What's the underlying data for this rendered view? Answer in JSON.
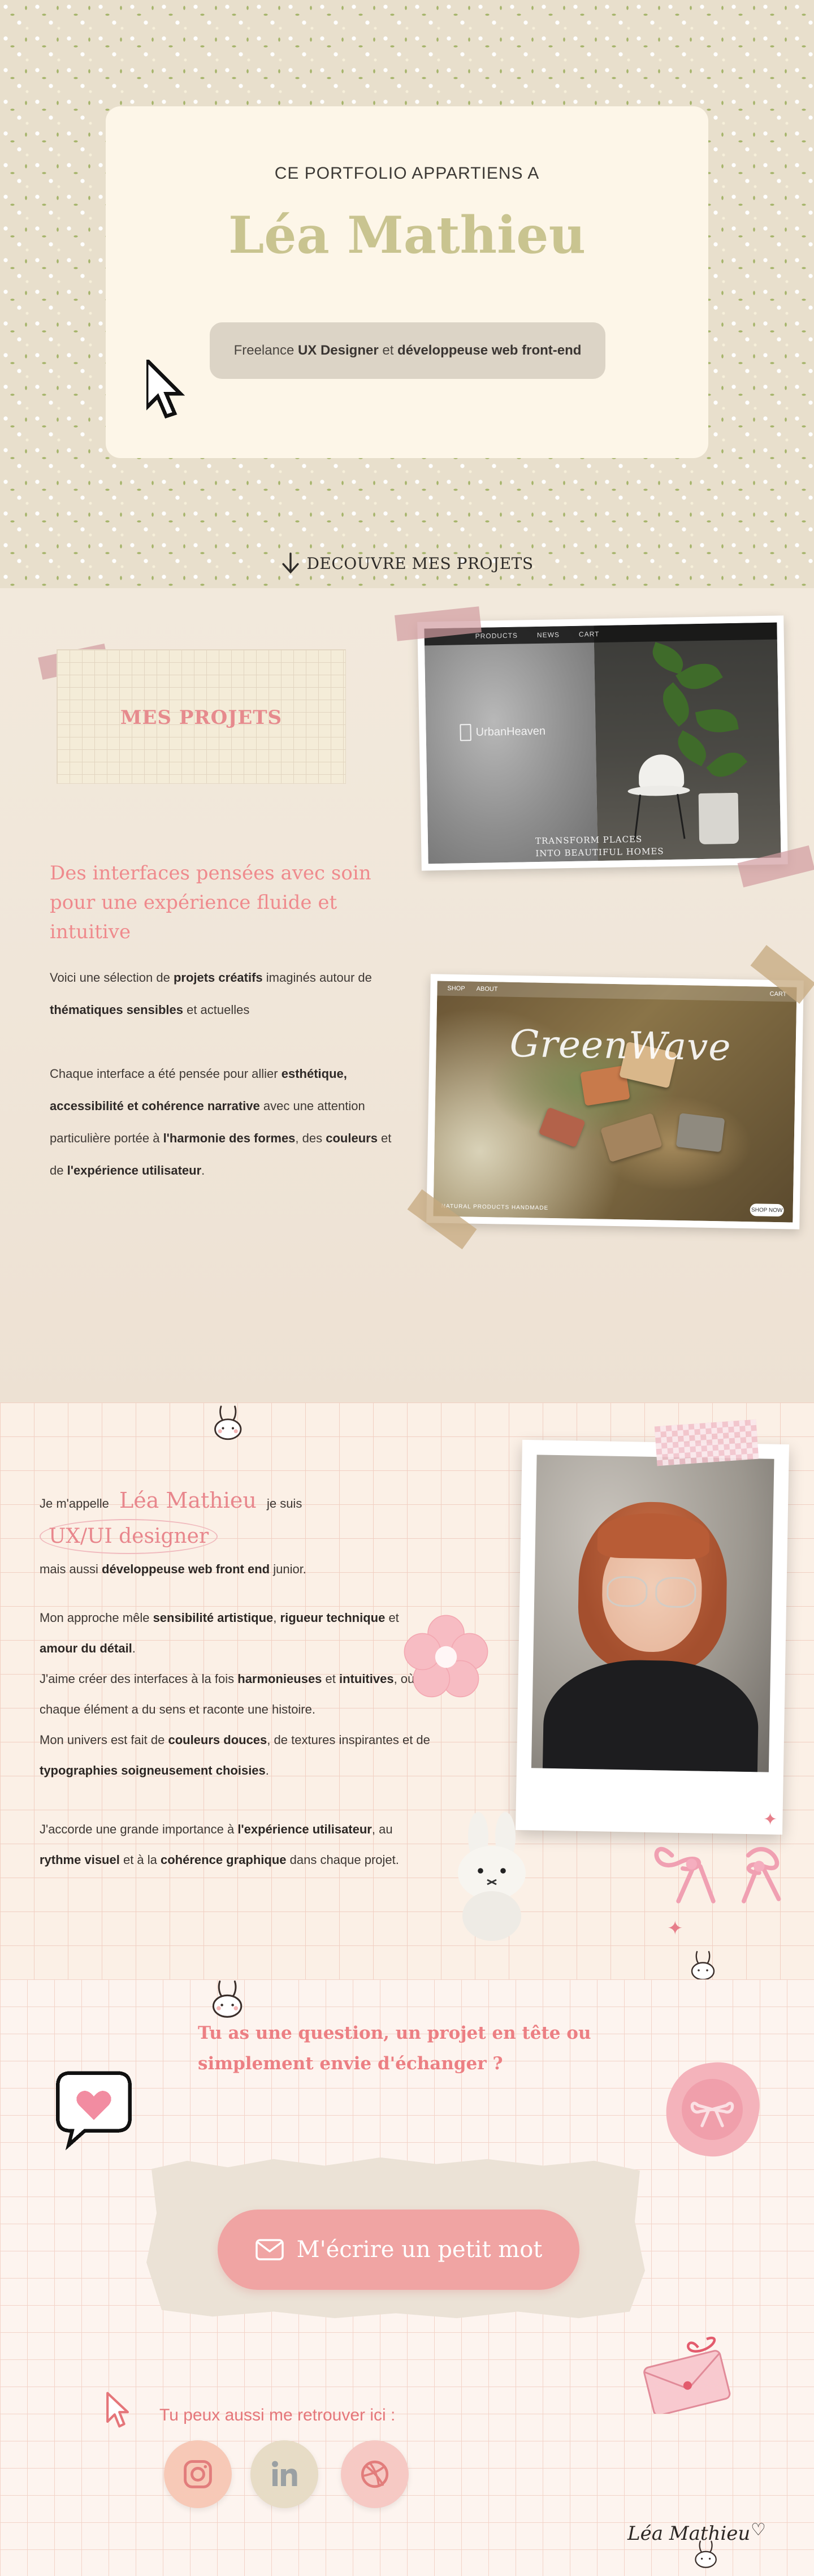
{
  "hero": {
    "subtitle": "CE PORTFOLIO APPARTIENS A",
    "name": "Léa Mathieu",
    "tagline_prefix": "Freelance ",
    "tagline_bold_1": "UX Designer",
    "tagline_mid": " et ",
    "tagline_bold_2": "développeuse web front-end",
    "discover_label": "DECOUVRE MES PROJETS"
  },
  "projects": {
    "section_label": "MES PROJETS",
    "heading": "Des interfaces pensées avec soin pour une expérience fluide et intuitive",
    "p1": [
      "Voici une sélection de ",
      "projets créatifs",
      " imaginés autour de ",
      "thématiques sensibles",
      " et actuelles"
    ],
    "p2": [
      " Chaque interface a été pensée pour allier ",
      "esthétique, accessibilité et cohérence narrative",
      " avec une attention particulière portée à ",
      "l'harmonie des formes",
      ", des ",
      "couleurs",
      " et de ",
      "l'expérience utilisateur",
      "."
    ],
    "urban": {
      "nav": [
        "PRODUCTS",
        "NEWS",
        "CART"
      ],
      "logo": "UrbanHeaven",
      "tagline_1": "TRANSFORM PLACES",
      "tagline_2": "INTO BEAUTIFUL HOMES"
    },
    "greenwave": {
      "nav": [
        "SHOP",
        "ABOUT",
        "CART"
      ],
      "title": "GreenWave",
      "footer": "NATURAL PRODUCTS HANDMADE",
      "button": "SHOP NOW"
    }
  },
  "about": {
    "intro_1": "Je m'appelle ",
    "intro_name": "Léa Mathieu",
    "intro_2": " je suis ",
    "intro_role": "UX/UI designer",
    "intro_3": " mais aussi ",
    "intro_bold": "développeuse web front end",
    "intro_4": " junior.",
    "approach_1": "Mon approche mêle ",
    "approach_b1": "sensibilité artistique",
    "approach_2": ", ",
    "approach_b2": "rigueur technique",
    "approach_3": " et ",
    "approach_b3": "amour du détail",
    "approach_4": ".",
    "create_1": " J'aime créer des interfaces à la fois ",
    "create_b1": "harmonieuses",
    "create_2": " et ",
    "create_b2": "intuitives",
    "create_3": ", où chaque élément a du sens et raconte une histoire.",
    "universe_1": "Mon univers est fait de ",
    "universe_b1": "couleurs douces",
    "universe_2": ", de textures inspirantes et de ",
    "universe_b2": "typographies soigneusement choisies",
    "universe_3": ".",
    "ux_1": "J'accorde une grande importance à ",
    "ux_b1": "l'expérience utilisateur",
    "ux_2": ", au ",
    "ux_b2": "rythme visuel",
    "ux_3": " et à la ",
    "ux_b3": "cohérence graphique",
    "ux_4": " dans chaque projet."
  },
  "contact": {
    "question_1": "Tu as une question, un projet en tête ou",
    "question_2": "simplement envie d'échanger ?",
    "cta_label": "M'écrire un petit mot",
    "find_me": "Tu peux aussi me retrouver ici :",
    "socials": [
      {
        "name": "Instagram",
        "icon": "instagram-icon",
        "color": "#f7c9b7"
      },
      {
        "name": "LinkedIn",
        "icon": "linkedin-icon",
        "color": "#e7dcc6"
      },
      {
        "name": "Dribbble",
        "icon": "dribbble-icon",
        "color": "#f6c9c4"
      }
    ],
    "signature": "Léa Mathieu"
  },
  "colors": {
    "accent_pink": "#ef8a8d",
    "hero_name": "#c9c490",
    "cta_bg": "#f0a4a3"
  }
}
